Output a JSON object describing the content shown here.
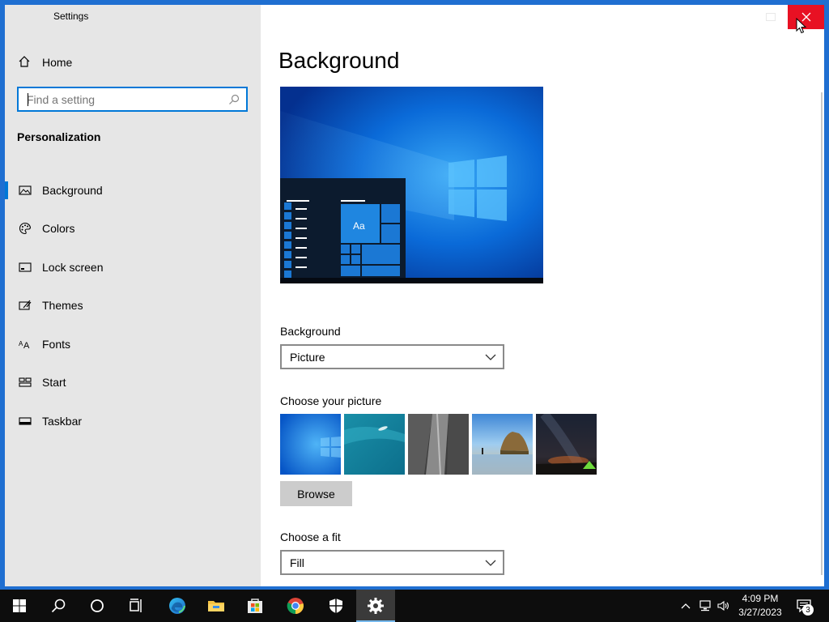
{
  "window": {
    "title": "Settings",
    "close_icon": "close-icon"
  },
  "sidebar": {
    "home_label": "Home",
    "search_placeholder": "Find a setting",
    "section_title": "Personalization",
    "items": [
      {
        "label": "Background",
        "icon": "picture-icon",
        "active": true
      },
      {
        "label": "Colors",
        "icon": "palette-icon",
        "active": false
      },
      {
        "label": "Lock screen",
        "icon": "lock-screen-icon",
        "active": false
      },
      {
        "label": "Themes",
        "icon": "themes-icon",
        "active": false
      },
      {
        "label": "Fonts",
        "icon": "fonts-icon",
        "active": false
      },
      {
        "label": "Start",
        "icon": "start-icon",
        "active": false
      },
      {
        "label": "Taskbar",
        "icon": "taskbar-icon",
        "active": false
      }
    ]
  },
  "main": {
    "title": "Background",
    "preview": {
      "sample_text": "Aa"
    },
    "background_label": "Background",
    "background_value": "Picture",
    "choose_picture_label": "Choose your picture",
    "pictures": [
      "windows-default",
      "ocean-aerial",
      "rock-cliff",
      "beach-rocks",
      "night-sky-tent"
    ],
    "browse_label": "Browse",
    "choose_fit_label": "Choose a fit",
    "fit_value": "Fill"
  },
  "taskbar": {
    "buttons": [
      "start-icon",
      "search-icon",
      "cortana-icon",
      "task-view-icon",
      "edge-icon",
      "file-explorer-icon",
      "store-icon",
      "chrome-icon",
      "security-icon",
      "settings-icon"
    ],
    "active_button": "settings-icon",
    "time": "4:09 PM",
    "date": "3/27/2023",
    "notification_count": "3"
  },
  "colors": {
    "accent": "#0078d7",
    "close_red": "#e81123",
    "sidebar_bg": "#e6e6e6",
    "taskbar_bg": "#0d0d0d"
  }
}
